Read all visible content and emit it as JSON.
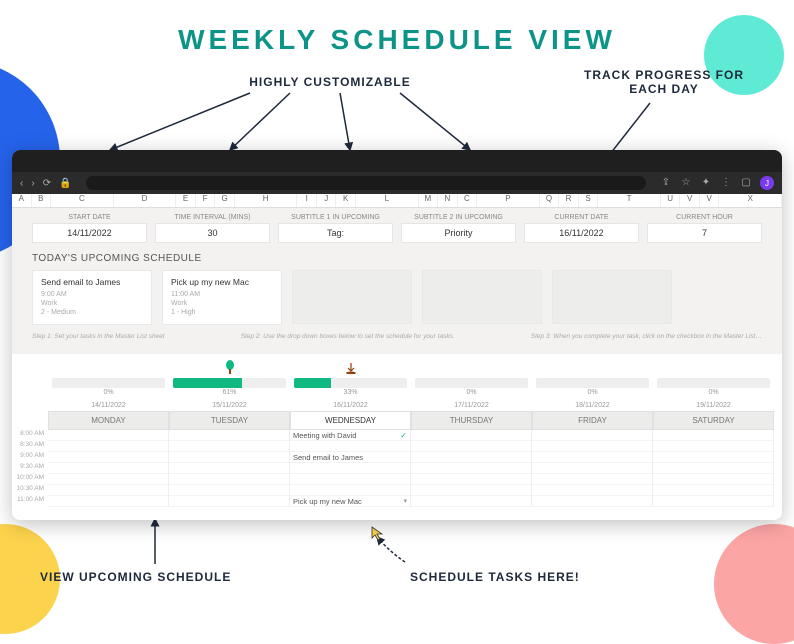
{
  "title": "WEEKLY SCHEDULE VIEW",
  "annotations": {
    "customizable": "HIGHLY CUSTOMIZABLE",
    "track": "TRACK PROGRESS FOR EACH DAY",
    "upcoming": "VIEW UPCOMING SCHEDULE",
    "schedule": "SCHEDULE TASKS HERE!"
  },
  "browser": {
    "avatar": "J"
  },
  "columns": [
    "A",
    "B",
    "C",
    "D",
    "E",
    "F",
    "G",
    "H",
    "I",
    "J",
    "K",
    "L",
    "M",
    "N",
    "C",
    "P",
    "Q",
    "R",
    "S",
    "T",
    "U",
    "V",
    "V",
    "X"
  ],
  "config": [
    {
      "label": "START DATE",
      "value": "14/11/2022"
    },
    {
      "label": "TIME INTERVAL (MINS)",
      "value": "30"
    },
    {
      "label": "SUBTITLE 1 IN UPCOMING",
      "value": "Tag:"
    },
    {
      "label": "SUBTITLE 2 IN UPCOMING",
      "value": "Priority"
    },
    {
      "label": "CURRENT DATE",
      "value": "16/11/2022"
    },
    {
      "label": "CURRENT HOUR",
      "value": "7"
    }
  ],
  "upcoming": {
    "title": "TODAY'S UPCOMING SCHEDULE",
    "cards": [
      {
        "title": "Send email to James",
        "time": "9:00 AM",
        "tag": "Work",
        "priority": "2 - Medium"
      },
      {
        "title": "Pick up my new Mac",
        "time": "11:00 AM",
        "tag": "Work",
        "priority": "1 - High"
      }
    ],
    "steps": [
      "Step 1: Set your tasks in the Master List sheet",
      "Step 2: Use the drop down boxes below to set the schedule for your tasks.",
      "Step 3: When you complete your task, click on the checkbox in the Master List…"
    ]
  },
  "week": {
    "progress": [
      0,
      61,
      33,
      0,
      0,
      0
    ],
    "dates": [
      "14/11/2022",
      "15/11/2022",
      "16/11/2022",
      "17/11/2022",
      "18/11/2022",
      "19/11/2022"
    ],
    "days": [
      "MONDAY",
      "TUESDAY",
      "WEDNESDAY",
      "THURSDAY",
      "FRIDAY",
      "SATURDAY"
    ],
    "active_day": 2,
    "times": [
      "8:00 AM",
      "8:30 AM",
      "9:00 AM",
      "9:30 AM",
      "10:00 AM",
      "10:30 AM",
      "11:00 AM"
    ],
    "wednesday_tasks": {
      "0": {
        "text": "Meeting with David",
        "done": true
      },
      "2": {
        "text": "Send email to James",
        "done": false
      },
      "6": {
        "text": "Pick up my new Mac",
        "done": false,
        "dropdown": true
      }
    }
  }
}
